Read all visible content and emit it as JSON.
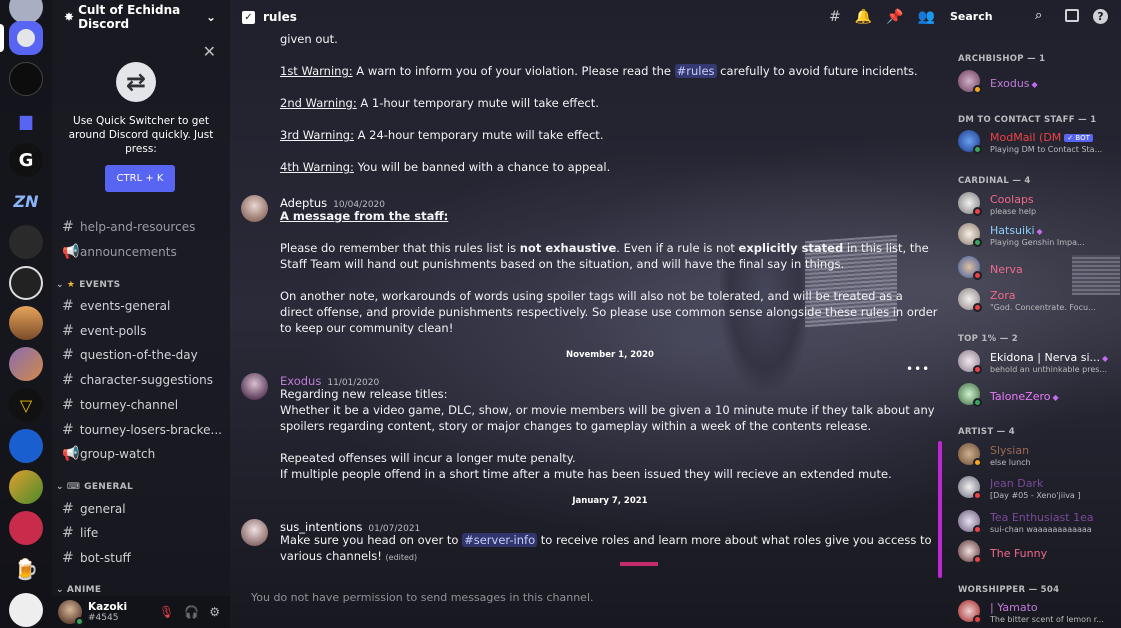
{
  "server_name": "Cult of Echidna Discord",
  "quick_switcher": {
    "text": "Use Quick Switcher to get around Discord quickly. Just press:",
    "button": "CTRL + K"
  },
  "channels": {
    "top": [
      {
        "name": "help-and-resources"
      },
      {
        "name": "announcements"
      }
    ],
    "events_category": "EVENTS",
    "events": [
      {
        "name": "events-general"
      },
      {
        "name": "event-polls"
      },
      {
        "name": "question-of-the-day"
      },
      {
        "name": "character-suggestions"
      },
      {
        "name": "tourney-channel"
      },
      {
        "name": "tourney-losers-bracke..."
      },
      {
        "name": "group-watch"
      }
    ],
    "general_category": "GENERAL",
    "general": [
      {
        "name": "general"
      },
      {
        "name": "life"
      },
      {
        "name": "bot-stuff"
      }
    ],
    "anime_category": "ANIME"
  },
  "user": {
    "name": "Kazoki",
    "tag": "#4545"
  },
  "topbar": {
    "channel": "rules",
    "search": "Search"
  },
  "messages": {
    "given_out": "given out.",
    "warn1_label": "1st Warning:",
    "warn1_pre": " A warn to inform you of your violation. Please read the ",
    "warn1_mention": "#rules",
    "warn1_post": " carefully to avoid future incidents.",
    "warn2_label": "2nd Warning:",
    "warn2_text": " A 1-hour temporary mute will take effect.",
    "warn3_label": "3rd Warning:",
    "warn3_text": " A 24-hour temporary mute will take effect.",
    "warn4_label": "4th Warning:",
    "warn4_text": " You will be banned with a chance to appeal.",
    "adeptus": {
      "author": "Adeptus",
      "timestamp": "10/04/2020",
      "heading": "A message from the staff:",
      "p1_a": "Please do remember that this rules list is ",
      "p1_b": "not exhaustive",
      "p1_c": ". Even if a rule is not ",
      "p1_d": "explicitly stated",
      "p1_e": " in this list, the",
      "p1_line2": "Staff Team will hand out punishments based on the situation, and will have the final say in things.",
      "p2_line1": "On another note, workarounds of words using spoiler tags will also not be tolerated, and will be treated as a",
      "p2_line2": "direct offense, and provide punishments respectively. So please use common sense alongside these rules in order",
      "p2_line3": "to keep our community clean!"
    },
    "divider1": "November 1, 2020",
    "exodus": {
      "author": "Exodus",
      "timestamp": "11/01/2020",
      "l1": "Regarding new release titles:",
      "l2": "Whether it be a video game, DLC, show, or movie members will be given a 10 minute mute if they talk about any",
      "l3": "spoilers regarding content, story or major changes to gameplay within a week of the contents release.",
      "l4": "Repeated offenses will incur a longer mute penalty.",
      "l5": "If multiple people offend in a short time after a mute has been issued they will recieve an extended mute."
    },
    "divider2": "January 7, 2021",
    "sus": {
      "author": "sus_intentions",
      "timestamp": "01/07/2021",
      "l1_pre": "Make sure you head on over to ",
      "l1_mention": "#server-info",
      "l1_post": " to receive roles and learn more about what roles give you access to",
      "l2": "various channels!",
      "edited": "(edited)"
    },
    "no_permission": "You do not have permission to send messages in this channel."
  },
  "members": {
    "archbishop": "ARCHBISHOP — 1",
    "dm_staff": "DM TO CONTACT STAFF — 1",
    "cardinal": "CARDINAL — 4",
    "top1": "TOP 1% — 2",
    "artist": "ARTIST — 4",
    "worshipper": "WORSHIPPER — 504",
    "list": [
      {
        "name": "Exodus",
        "status": "",
        "color": "#c07bd8"
      },
      {
        "name": "ModMail (DM",
        "status": "Playing DM to Contact Sta...",
        "color": "#ed4245",
        "bot": "✓ BOT"
      },
      {
        "name": "Coolaps",
        "status": "please help",
        "color": "#f06a8c"
      },
      {
        "name": "Hatsuiki",
        "status": "Playing Genshin Impa...",
        "color": "#8ad0ff"
      },
      {
        "name": "Nerva",
        "status": "",
        "color": "#f06a8c"
      },
      {
        "name": "Zora",
        "status": "\"God. Concentrate. Focu...",
        "color": "#f06a8c"
      },
      {
        "name": "Ekidona | Nerva si...",
        "status": "behold an unthinkable pres...",
        "color": "#ffffff"
      },
      {
        "name": "TaloneZero",
        "status": "",
        "color": "#e879f9"
      },
      {
        "name": "Slysian",
        "status": "else lunch",
        "color": "#9b6a54"
      },
      {
        "name": "Jean Dark",
        "status": "[Day #05 - Xeno'jiiva ]",
        "color": "#7a4a9a"
      },
      {
        "name": "Tea Enthusiast 1ea",
        "status": "sui-chan waaaaaaaaaaaa",
        "color": "#7a4a9a"
      },
      {
        "name": "The Funny",
        "status": "",
        "color": "#f06a8c"
      },
      {
        "name": "| Yamato",
        "status": "The bitter scent of lemon r...",
        "color": "#c07bd8"
      }
    ]
  }
}
